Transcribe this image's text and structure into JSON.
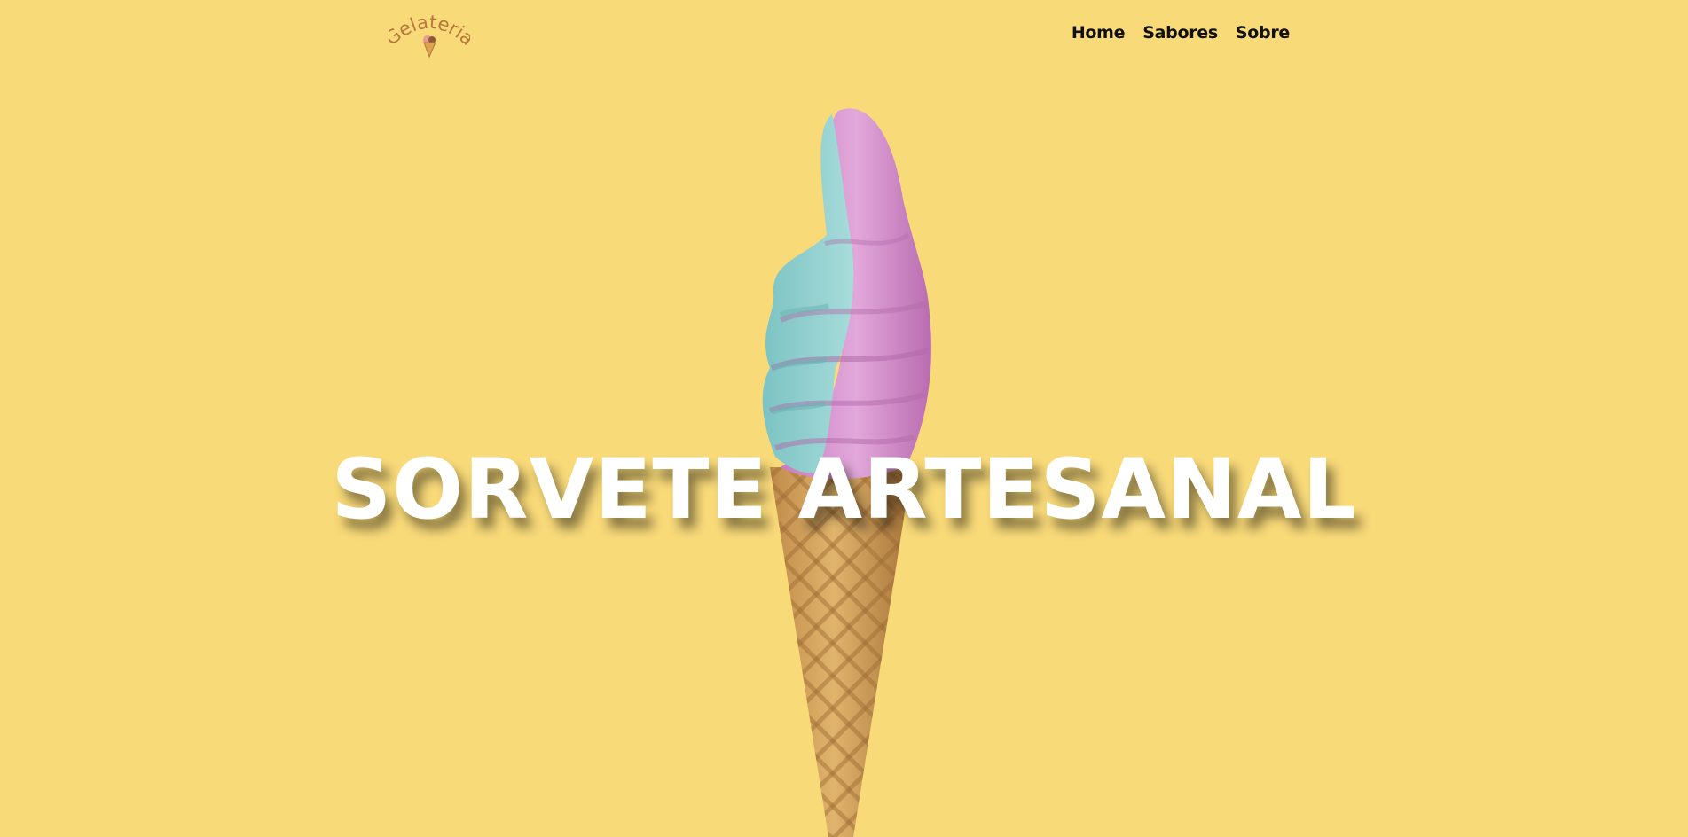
{
  "brand": {
    "logo_text": "Gelateria",
    "logo_icon": "ice-cream-cone-icon"
  },
  "nav": {
    "items": [
      {
        "label": "Home"
      },
      {
        "label": "Sabores"
      },
      {
        "label": "Sobre"
      }
    ]
  },
  "hero": {
    "title": "SORVETE ARTESANAL",
    "image": "soft-serve-ice-cream-cone"
  },
  "colors": {
    "background": "#f9da79",
    "title": "#ffffff",
    "nav_text": "#111111",
    "logo": "#b8773a",
    "cream_pink": "#d592cf",
    "cream_teal": "#8fcfcf",
    "cone": "#d8a862"
  }
}
